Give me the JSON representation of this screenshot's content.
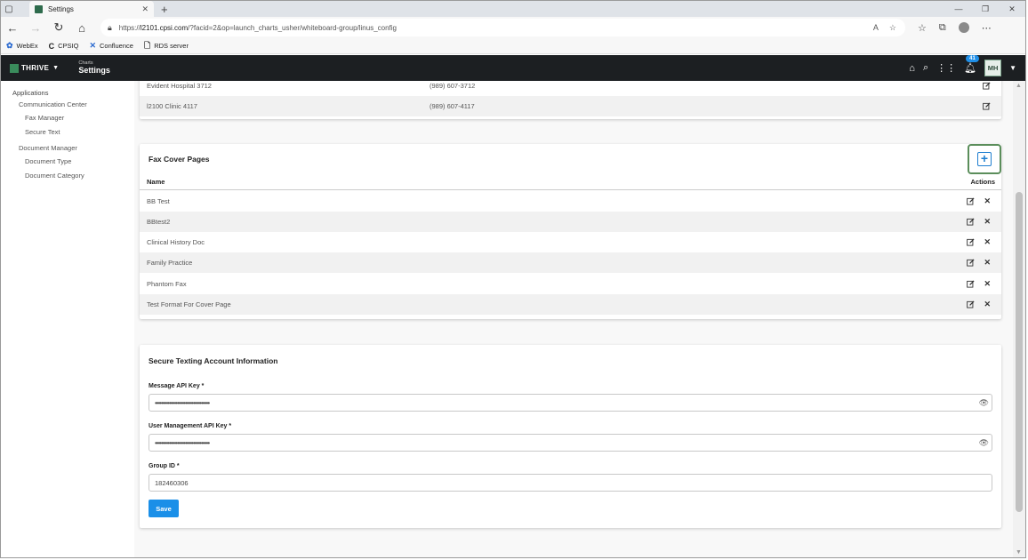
{
  "browser": {
    "tab_title": "Settings",
    "tab_close": "✕",
    "new_tab": "+",
    "url_prefix": "https://",
    "url_host": "l2101.cpsi.com",
    "url_path": "/?facid=2&op=launch_charts_usher/whiteboard-group/linus_config",
    "bookmarks": [
      {
        "icon": "webex-icon",
        "label": "WebEx"
      },
      {
        "icon": "cpsiq-icon",
        "label": "CPSIQ"
      },
      {
        "icon": "confluence-icon",
        "label": "Confluence"
      },
      {
        "icon": "document-icon",
        "label": "RDS server"
      }
    ]
  },
  "app": {
    "brand": "THRIVE",
    "module_small": "Charts",
    "module_title": "Settings",
    "notification_count": "41",
    "user_initials": "MH"
  },
  "sidebar": {
    "root": "Applications",
    "groups": [
      {
        "label": "Communication Center",
        "items": [
          "Fax Manager",
          "Secure Text"
        ]
      },
      {
        "label": "Document Manager",
        "items": [
          "Document Type",
          "Document Category"
        ]
      }
    ]
  },
  "locations": {
    "rows": [
      {
        "name": "Evident Hospital 3712",
        "phone": "(989) 607-3712"
      },
      {
        "name": "l2100 Clinic 4117",
        "phone": "(989) 607-4117"
      }
    ]
  },
  "fax_cover": {
    "title": "Fax Cover Pages",
    "col_name": "Name",
    "col_actions": "Actions",
    "rows": [
      "BB Test",
      "BBtest2",
      "Clinical History Doc",
      "Family Practice",
      "Phantom Fax",
      "Test Format For Cover Page"
    ]
  },
  "secure_text": {
    "title": "Secure Texting Account Information",
    "message_key_label": "Message API Key *",
    "message_key_value": "••••••••••••••••••••••••••••••••••",
    "user_key_label": "User Management API Key *",
    "user_key_value": "••••••••••••••••••••••••••••••••••",
    "group_label": "Group ID *",
    "group_value": "182460306",
    "save_label": "Save"
  },
  "colors": {
    "header_bg": "#1c1f22",
    "brand_green": "#3a8c5c",
    "accent_blue": "#1a8fe8",
    "highlight_green": "#5b8e5b"
  }
}
